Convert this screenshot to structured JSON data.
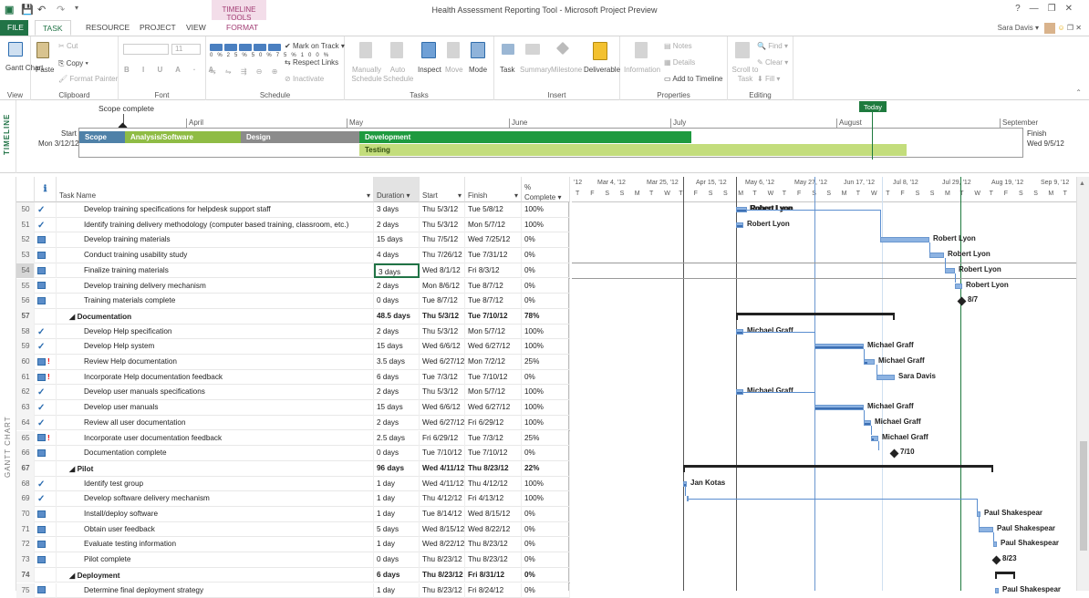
{
  "window": {
    "title": "Health Assessment Reporting Tool - Microsoft Project Preview",
    "contextual_tab_header": "TIMELINE TOOLS",
    "user_name": "Sara Davis",
    "controls": [
      "?",
      "—",
      "❐",
      "✕"
    ]
  },
  "tabs": [
    "FILE",
    "TASK",
    "RESOURCE",
    "PROJECT",
    "VIEW",
    "FORMAT"
  ],
  "ribbon": {
    "groups": {
      "view": "View",
      "clipboard": "Clipboard",
      "font": "Font",
      "schedule": "Schedule",
      "tasks": "Tasks",
      "insert": "Insert",
      "properties": "Properties",
      "editing": "Editing"
    },
    "buttons": {
      "gantt_chart": "Gantt Chart",
      "paste": "Paste",
      "cut": "Cut",
      "copy": "Copy",
      "format_painter": "Format Painter",
      "font_size": "11",
      "mark_on_track": "Mark on Track",
      "respect_links": "Respect Links",
      "inactivate": "Inactivate",
      "manually_schedule": "Manually Schedule",
      "auto_schedule": "Auto Schedule",
      "inspect": "Inspect",
      "move": "Move",
      "mode": "Mode",
      "task": "Task",
      "summary": "Summary",
      "milestone": "Milestone",
      "deliverable": "Deliverable",
      "information": "Information",
      "notes": "Notes",
      "details": "Details",
      "add_to_timeline": "Add to Timeline",
      "scroll_to_task": "Scroll to Task",
      "find": "Find",
      "clear": "Clear",
      "fill": "Fill"
    },
    "pct_buttons": [
      "0%",
      "25%",
      "50%",
      "75%",
      "100%"
    ]
  },
  "timeline": {
    "side_label": "TIMELINE",
    "callout": "Scope complete",
    "start_label": "Start",
    "start_date": "Mon 3/12/12",
    "finish_label": "Finish",
    "finish_date": "Wed 9/5/12",
    "today_label": "Today",
    "months": [
      "April",
      "May",
      "June",
      "July",
      "August",
      "September"
    ],
    "bars": [
      {
        "label": "Scope",
        "color": "#4f81a8"
      },
      {
        "label": "Analysis/Software",
        "color": "#8fbc45"
      },
      {
        "label": "Design",
        "color": "#8b8b8b"
      },
      {
        "label": "Development",
        "color": "#1e9a3f"
      },
      {
        "label": "Testing",
        "color": "#c3dd7c"
      }
    ]
  },
  "grid": {
    "side_label": "GANTT CHART",
    "headers": {
      "info": "ℹ",
      "task_name": "Task Name",
      "duration": "Duration",
      "start": "Start",
      "finish": "Finish",
      "complete_pct": "%",
      "complete": "Complete"
    },
    "rows": [
      {
        "id": "50",
        "ind": "check",
        "name": "Develop training specifications for helpdesk support staff",
        "dur": "3 days",
        "start": "Thu 5/3/12",
        "finish": "Tue 5/8/12",
        "pct": "100%"
      },
      {
        "id": "51",
        "ind": "check",
        "name": "Identify training delivery methodology (computer based training, classroom, etc.)",
        "dur": "2 days",
        "start": "Thu 5/3/12",
        "finish": "Mon 5/7/12",
        "pct": "100%"
      },
      {
        "id": "52",
        "ind": "cal",
        "name": "Develop training materials",
        "dur": "15 days",
        "start": "Thu 7/5/12",
        "finish": "Wed 7/25/12",
        "pct": "0%"
      },
      {
        "id": "53",
        "ind": "cal",
        "name": "Conduct training usability study",
        "dur": "4 days",
        "start": "Thu 7/26/12",
        "finish": "Tue 7/31/12",
        "pct": "0%"
      },
      {
        "id": "54",
        "ind": "cal",
        "name": "Finalize training materials",
        "dur": "3 days",
        "start": "Wed 8/1/12",
        "finish": "Fri 8/3/12",
        "pct": "0%",
        "selected": true
      },
      {
        "id": "55",
        "ind": "cal",
        "name": "Develop training delivery mechanism",
        "dur": "2 days",
        "start": "Mon 8/6/12",
        "finish": "Tue 8/7/12",
        "pct": "0%"
      },
      {
        "id": "56",
        "ind": "cal",
        "name": "Training materials complete",
        "dur": "0 days",
        "start": "Tue 8/7/12",
        "finish": "Tue 8/7/12",
        "pct": "0%"
      },
      {
        "id": "57",
        "ind": "",
        "name": "Documentation",
        "dur": "48.5 days",
        "start": "Thu 5/3/12",
        "finish": "Tue 7/10/12",
        "pct": "78%",
        "summary": true
      },
      {
        "id": "58",
        "ind": "check",
        "name": "Develop Help specification",
        "dur": "2 days",
        "start": "Thu 5/3/12",
        "finish": "Mon 5/7/12",
        "pct": "100%"
      },
      {
        "id": "59",
        "ind": "check",
        "name": "Develop Help system",
        "dur": "15 days",
        "start": "Wed 6/6/12",
        "finish": "Wed 6/27/12",
        "pct": "100%"
      },
      {
        "id": "60",
        "ind": "cal-excl",
        "name": "Review Help documentation",
        "dur": "3.5 days",
        "start": "Wed 6/27/12",
        "finish": "Mon 7/2/12",
        "pct": "25%"
      },
      {
        "id": "61",
        "ind": "cal-excl",
        "name": "Incorporate Help documentation feedback",
        "dur": "6 days",
        "start": "Tue 7/3/12",
        "finish": "Tue 7/10/12",
        "pct": "0%"
      },
      {
        "id": "62",
        "ind": "check",
        "name": "Develop user manuals specifications",
        "dur": "2 days",
        "start": "Thu 5/3/12",
        "finish": "Mon 5/7/12",
        "pct": "100%"
      },
      {
        "id": "63",
        "ind": "check",
        "name": "Develop user manuals",
        "dur": "15 days",
        "start": "Wed 6/6/12",
        "finish": "Wed 6/27/12",
        "pct": "100%"
      },
      {
        "id": "64",
        "ind": "check",
        "name": "Review all user documentation",
        "dur": "2 days",
        "start": "Wed 6/27/12",
        "finish": "Fri 6/29/12",
        "pct": "100%"
      },
      {
        "id": "65",
        "ind": "cal-excl",
        "name": "Incorporate user documentation feedback",
        "dur": "2.5 days",
        "start": "Fri 6/29/12",
        "finish": "Tue 7/3/12",
        "pct": "25%"
      },
      {
        "id": "66",
        "ind": "cal",
        "name": "Documentation complete",
        "dur": "0 days",
        "start": "Tue 7/10/12",
        "finish": "Tue 7/10/12",
        "pct": "0%"
      },
      {
        "id": "67",
        "ind": "",
        "name": "Pilot",
        "dur": "96 days",
        "start": "Wed 4/11/12",
        "finish": "Thu 8/23/12",
        "pct": "22%",
        "summary": true
      },
      {
        "id": "68",
        "ind": "check",
        "name": "Identify test group",
        "dur": "1 day",
        "start": "Wed 4/11/12",
        "finish": "Thu 4/12/12",
        "pct": "100%"
      },
      {
        "id": "69",
        "ind": "check",
        "name": "Develop software delivery mechanism",
        "dur": "1 day",
        "start": "Thu 4/12/12",
        "finish": "Fri 4/13/12",
        "pct": "100%"
      },
      {
        "id": "70",
        "ind": "cal",
        "name": "Install/deploy software",
        "dur": "1 day",
        "start": "Tue 8/14/12",
        "finish": "Wed 8/15/12",
        "pct": "0%"
      },
      {
        "id": "71",
        "ind": "cal",
        "name": "Obtain user feedback",
        "dur": "5 days",
        "start": "Wed 8/15/12",
        "finish": "Wed 8/22/12",
        "pct": "0%"
      },
      {
        "id": "72",
        "ind": "cal",
        "name": "Evaluate testing information",
        "dur": "1 day",
        "start": "Wed 8/22/12",
        "finish": "Thu 8/23/12",
        "pct": "0%"
      },
      {
        "id": "73",
        "ind": "cal",
        "name": "Pilot complete",
        "dur": "0 days",
        "start": "Thu 8/23/12",
        "finish": "Thu 8/23/12",
        "pct": "0%"
      },
      {
        "id": "74",
        "ind": "",
        "name": "Deployment",
        "dur": "6 days",
        "start": "Thu 8/23/12",
        "finish": "Fri 8/31/12",
        "pct": "0%",
        "summary": true
      },
      {
        "id": "75",
        "ind": "cal",
        "name": "Determine final deployment strategy",
        "dur": "1 day",
        "start": "Thu 8/23/12",
        "finish": "Fri 8/24/12",
        "pct": "0%"
      }
    ]
  },
  "gantt": {
    "weeks": [
      "'12",
      "Mar 4, '12",
      "Mar 25, '12",
      "Apr 15, '12",
      "May 6, '12",
      "May 27, '12",
      "Jun 17, '12",
      "Jul 8, '12",
      "Jul 29, '12",
      "Aug 19, '12",
      "Sep 9, '12"
    ],
    "day_letters": [
      "T",
      "F",
      "S",
      "S",
      "M",
      "T",
      "W",
      "T",
      "F",
      "S",
      "S",
      "M",
      "T",
      "W",
      "T",
      "F",
      "S",
      "S",
      "M",
      "T",
      "W",
      "T",
      "F",
      "S",
      "S",
      "M",
      "T",
      "W",
      "T",
      "F",
      "S",
      "S",
      "M",
      "T"
    ],
    "labels": {
      "r50": "Robert Lyon",
      "r51": "Robert Lyon",
      "r52": "Robert Lyon",
      "r53": "Robert Lyon",
      "r54": "Robert Lyon",
      "r55": "Robert Lyon",
      "r56": "8/7",
      "r58": "Michael Graff",
      "r59": "Michael Graff",
      "r60": "Michael Graff",
      "r61": "Sara Davis",
      "r62": "Michael Graff",
      "r63": "Michael Graff",
      "r64": "Michael Graff",
      "r65": "Michael Graff",
      "r66": "7/10",
      "r68": "Jan Kotas",
      "r70": "Paul Shakespear",
      "r71": "Paul Shakespear",
      "r72": "Paul Shakespear",
      "r73": "8/23",
      "r75": "Paul Shakespear"
    }
  }
}
